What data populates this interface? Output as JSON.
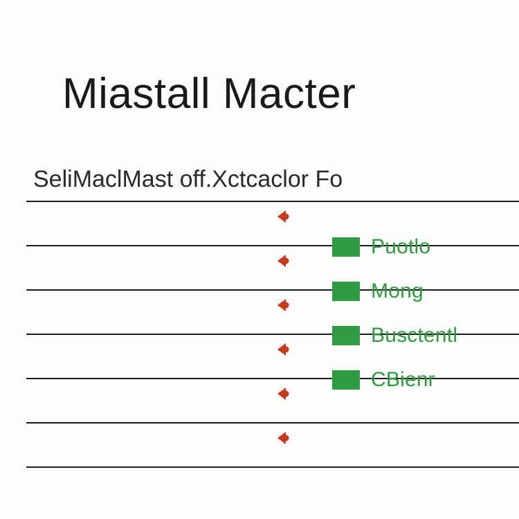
{
  "title": "Miastall Macter",
  "subtitle": "SeliMaclMast off.Xctcaclor Fo",
  "rules_count": 6,
  "arrow_color": "#c93a1d",
  "legend_color": "#2f9a3f",
  "legend": [
    {
      "label": "Puotlo"
    },
    {
      "label": "Mong"
    },
    {
      "label": "Busctentl"
    },
    {
      "label": "CBienr"
    }
  ]
}
